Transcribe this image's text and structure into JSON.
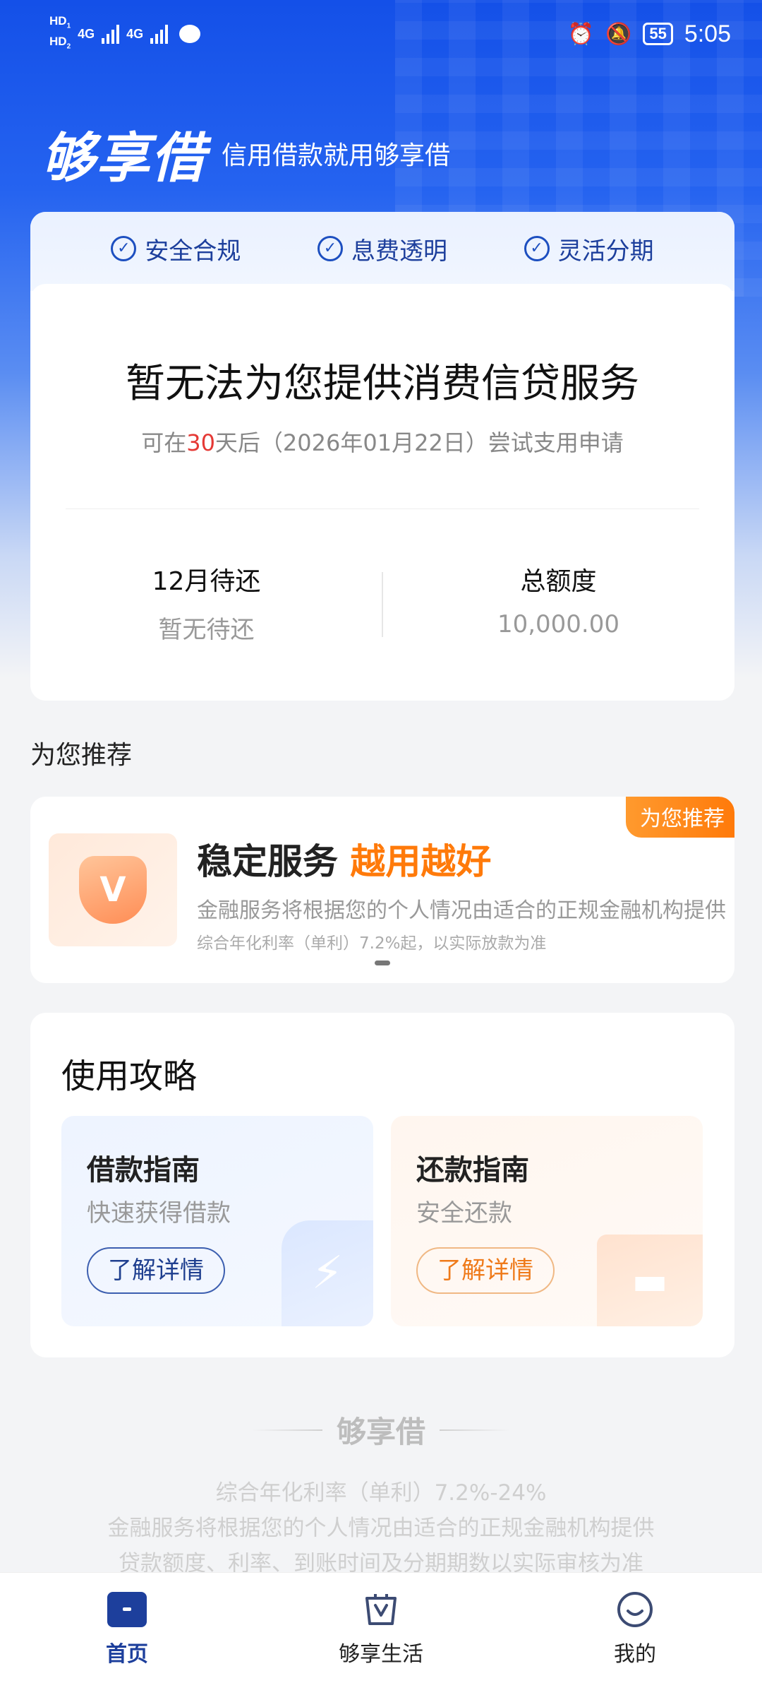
{
  "status_bar": {
    "hd1": "HD",
    "hd1_sub": "1",
    "hd2": "HD",
    "hd2_sub": "2",
    "net1": "4G",
    "net2": "4G",
    "battery": "55",
    "time": "5:05",
    "alarm_icon": "alarm-icon",
    "mute_icon": "bell-muted-icon"
  },
  "header": {
    "logo": "够享借",
    "slogan": "信用借款就用够享借"
  },
  "status_card": {
    "badges": [
      "安全合规",
      "息费透明",
      "灵活分期"
    ],
    "title": "暂无法为您提供消费信贷服务",
    "sub_prefix": "可在",
    "sub_days": "30",
    "sub_suffix": "天后（2026年01月22日）尝试支用申请",
    "left_label": "12月待还",
    "left_value": "暂无待还",
    "right_label": "总额度",
    "right_value": "10,000.00"
  },
  "recommend": {
    "section_title": "为您推荐",
    "tag": "为您推荐",
    "title_main": "稳定服务",
    "title_highlight": "越用越好",
    "desc": "金融服务将根据您的个人情况由适合的正规金融机构提供",
    "rate_note": "综合年化利率（单利）7.2%起，以实际放款为准"
  },
  "guide": {
    "title": "使用攻略",
    "items": [
      {
        "title": "借款指南",
        "subtitle": "快速获得借款",
        "button": "了解详情"
      },
      {
        "title": "还款指南",
        "subtitle": "安全还款",
        "button": "了解详情"
      }
    ]
  },
  "footer": {
    "brand": "够享借",
    "line1": "综合年化利率（单利）7.2%-24%",
    "line2": "金融服务将根据您的个人情况由适合的正规金融机构提供",
    "line3": "贷款额度、利率、到账时间及分期期数以实际审核为准"
  },
  "nav": {
    "items": [
      {
        "label": "首页",
        "icon": "home-icon"
      },
      {
        "label": "够享生活",
        "icon": "shopping-bag-icon"
      },
      {
        "label": "我的",
        "icon": "smiley-icon"
      }
    ],
    "active_color": "#1d3f9c"
  },
  "colors": {
    "brand_blue": "#1450e8",
    "accent_orange": "#ff7a0a",
    "days_red": "#e53935"
  }
}
